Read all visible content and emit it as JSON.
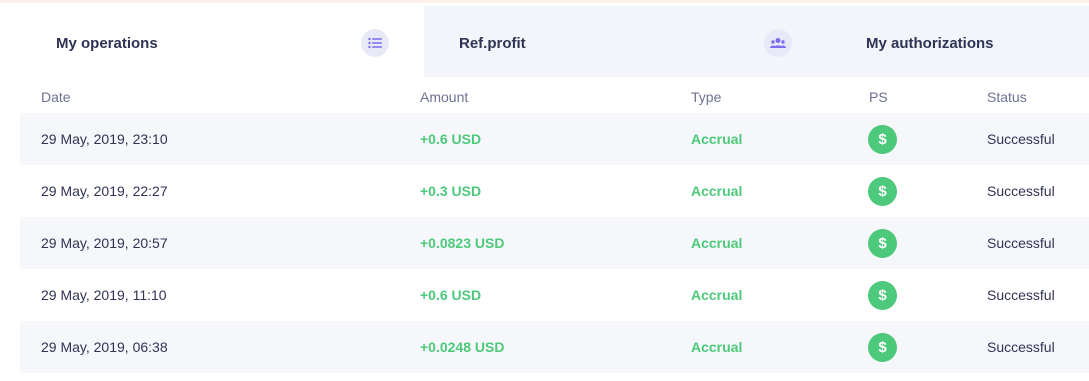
{
  "tabs": [
    {
      "label": "My operations",
      "icon": "list-icon",
      "active": true
    },
    {
      "label": "Ref.profit",
      "icon": "users-icon",
      "active": false
    },
    {
      "label": "My authorizations",
      "active": false
    }
  ],
  "table": {
    "columns": [
      "Date",
      "Amount",
      "Type",
      "PS",
      "Status"
    ],
    "rows": [
      {
        "date": "29 May, 2019, 23:10",
        "amount": "+0.6 USD",
        "type": "Accrual",
        "ps": "$",
        "status": "Successful"
      },
      {
        "date": "29 May, 2019, 22:27",
        "amount": "+0.3 USD",
        "type": "Accrual",
        "ps": "$",
        "status": "Successful"
      },
      {
        "date": "29 May, 2019, 20:57",
        "amount": "+0.0823 USD",
        "type": "Accrual",
        "ps": "$",
        "status": "Successful"
      },
      {
        "date": "29 May, 2019, 11:10",
        "amount": "+0.6 USD",
        "type": "Accrual",
        "ps": "$",
        "status": "Successful"
      },
      {
        "date": "29 May, 2019, 06:38",
        "amount": "+0.0248 USD",
        "type": "Accrual",
        "ps": "$",
        "status": "Successful"
      }
    ]
  },
  "colors": {
    "accent": "#7b6cf0",
    "success": "#4cc97b",
    "text": "#2f3354",
    "muted": "#6e7191"
  }
}
